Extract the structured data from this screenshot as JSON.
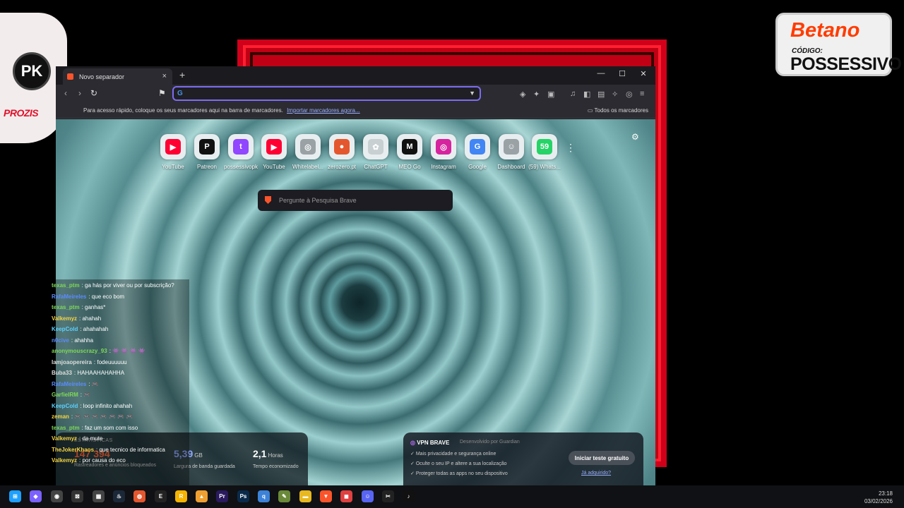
{
  "overlay": {
    "pk_logo_text": "PK",
    "pk_brand": "PROZIS",
    "betano_name": "Betano",
    "betano_code_label": "CÓDIGO:",
    "betano_code": "POSSESSIVO"
  },
  "browser": {
    "tab_title": "Novo separador",
    "tab_close": "×",
    "new_tab": "+",
    "window_controls": [
      "—",
      "☐",
      "✕"
    ],
    "url_engine_letter": "G",
    "url_value": "",
    "bookmarks_message": "Para acesso rápido, coloque os seus marcadores aqui na barra de marcadores.",
    "bookmarks_import": "Importar marcadores agora...",
    "all_bookmarks": "Todos os marcadores"
  },
  "colors": {
    "accent_purple": "#7c6cf0",
    "brave_orange": "#fb542b",
    "red_frame": "#d0001a"
  },
  "top_sites": [
    {
      "label": "YouTube",
      "icon": "youtube-icon",
      "glyph": "▶",
      "color": "#ff0033"
    },
    {
      "label": "Patreon",
      "icon": "patreon-icon",
      "glyph": "P",
      "color": "#111111"
    },
    {
      "label": "possessivopk",
      "icon": "twitch-icon",
      "glyph": "t",
      "color": "#9146ff"
    },
    {
      "label": "YouTube",
      "icon": "youtube-icon",
      "glyph": "▶",
      "color": "#ff0033"
    },
    {
      "label": "Whitelabel...",
      "icon": "globe-icon",
      "glyph": "◎",
      "color": "#9aa2a6"
    },
    {
      "label": "zerozero.pt",
      "icon": "zerozero-icon",
      "glyph": "●",
      "color": "#e4572e"
    },
    {
      "label": "ChatGPT",
      "icon": "chatgpt-icon",
      "glyph": "✿",
      "color": "#c8d0d2"
    },
    {
      "label": "MEO Go",
      "icon": "meo-icon",
      "glyph": "M",
      "color": "#111111"
    },
    {
      "label": "Instagram",
      "icon": "instagram-icon",
      "glyph": "◎",
      "color": "#d6249f"
    },
    {
      "label": "Google",
      "icon": "google-icon",
      "glyph": "G",
      "color": "#4285f4"
    },
    {
      "label": "Dashboard",
      "icon": "discord-icon",
      "glyph": "☺",
      "color": "#9aa2a6"
    },
    {
      "label": "(59) Whats...",
      "icon": "whatsapp-icon",
      "glyph": "59",
      "color": "#25d366"
    }
  ],
  "search": {
    "placeholder": "Pergunte à Pesquisa Brave"
  },
  "stats": {
    "heading": "ESTATÍSTICAS",
    "trackers": {
      "value": "147 394",
      "caption": "Rastreadores e anúncios bloqueados"
    },
    "bandwidth": {
      "value": "5,39",
      "unit": "GB",
      "caption": "Largura de banda guardada"
    },
    "time": {
      "value": "2,1",
      "unit": "Horas",
      "caption": "Tempo economizado"
    }
  },
  "vpn": {
    "title": "VPN BRAVE",
    "developer": "Desenvolvido por Guardian",
    "features": [
      "Mais privacidade e segurança online",
      "Oculte o seu IP e altere a sua localização",
      "Proteger todas as apps no seu dispositivo"
    ],
    "cta": "Iniciar teste gratuito",
    "already": "Já adquirido?"
  },
  "chat": [
    {
      "user": "texas_ptm",
      "color": "#7ed957",
      "text": ": ga hás por viver ou por subscrição?"
    },
    {
      "user": "RafaMeireles",
      "color": "#5b8cff",
      "text": ": que eco bom"
    },
    {
      "user": "texas_ptm",
      "color": "#7ed957",
      "text": ": ganhas*"
    },
    {
      "user": "Valkemyz",
      "color": "#f5d442",
      "text": ": ahahah"
    },
    {
      "user": "KeepCold",
      "color": "#5bd1ff",
      "text": ": ahahahah"
    },
    {
      "user": "n0cive",
      "color": "#5b8cff",
      "text": ": ahahha"
    },
    {
      "user": "anonymouscrazy_93",
      "color": "#7ed957",
      "text": ": 👾 👾 👾 👾"
    },
    {
      "user": "Iamjoaopereira",
      "color": "#dddddd",
      "text": ": fodeuuuuuu"
    },
    {
      "user": "Buba33",
      "color": "#dddddd",
      "text": ": HAHAAHAHAHHA"
    },
    {
      "user": "RafaMeireles",
      "color": "#5b8cff",
      "text": ": 🎮"
    },
    {
      "user": "GarfielRM",
      "color": "#7ed957",
      "text": ": 🎮"
    },
    {
      "user": "KeepCold",
      "color": "#5bd1ff",
      "text": ": loop infinito ahahah"
    },
    {
      "user": "zeman",
      "color": "#f5d442",
      "text": ": 🎮 🎮 🎮 🎮 🎮 🎮 🎮"
    },
    {
      "user": "texas_ptm",
      "color": "#7ed957",
      "text": ": faz um som com isso"
    },
    {
      "user": "Valkemyz",
      "color": "#f5d442",
      "text": ": da mute"
    },
    {
      "user": "TheJokerKhaos",
      "color": "#f5d442",
      "text": ": que tecnico de informatica"
    },
    {
      "user": "Valkemyz",
      "color": "#f5d442",
      "text": ": por causa do eco"
    }
  ],
  "taskbar": {
    "time": "23:18",
    "date": "03/02/2026",
    "icons": [
      {
        "name": "windows-start-icon",
        "glyph": "⊞",
        "color": "#1ea0ff"
      },
      {
        "name": "copilot-icon",
        "glyph": "◆",
        "color": "#7b61ff"
      },
      {
        "name": "obs-icon",
        "glyph": "◉",
        "color": "#444"
      },
      {
        "name": "xbox-icon",
        "glyph": "⊠",
        "color": "#333"
      },
      {
        "name": "app-icon",
        "glyph": "▦",
        "color": "#444"
      },
      {
        "name": "steam-icon",
        "glyph": "♨",
        "color": "#1b2838"
      },
      {
        "name": "ea-icon",
        "glyph": "◍",
        "color": "#e4572e"
      },
      {
        "name": "epic-icon",
        "glyph": "E",
        "color": "#222"
      },
      {
        "name": "rockstar-icon",
        "glyph": "R",
        "color": "#f5b400"
      },
      {
        "name": "affinity-icon",
        "glyph": "▲",
        "color": "#f0a030"
      },
      {
        "name": "premiere-icon",
        "glyph": "Pr",
        "color": "#2a1a5e"
      },
      {
        "name": "photoshop-icon",
        "glyph": "Ps",
        "color": "#0a2a4a"
      },
      {
        "name": "qbittorrent-icon",
        "glyph": "q",
        "color": "#3c82d8"
      },
      {
        "name": "notepad-icon",
        "glyph": "✎",
        "color": "#6a8a3a"
      },
      {
        "name": "file-explorer-icon",
        "glyph": "▬",
        "color": "#e8b820"
      },
      {
        "name": "brave-icon",
        "glyph": "▼",
        "color": "#fb542b"
      },
      {
        "name": "roblox-icon",
        "glyph": "◼",
        "color": "#e04040"
      },
      {
        "name": "discord-icon",
        "glyph": "☺",
        "color": "#5865f2"
      },
      {
        "name": "capcut-icon",
        "glyph": "✂",
        "color": "#222"
      },
      {
        "name": "tiktok-icon",
        "glyph": "♪",
        "color": "#111"
      }
    ]
  }
}
